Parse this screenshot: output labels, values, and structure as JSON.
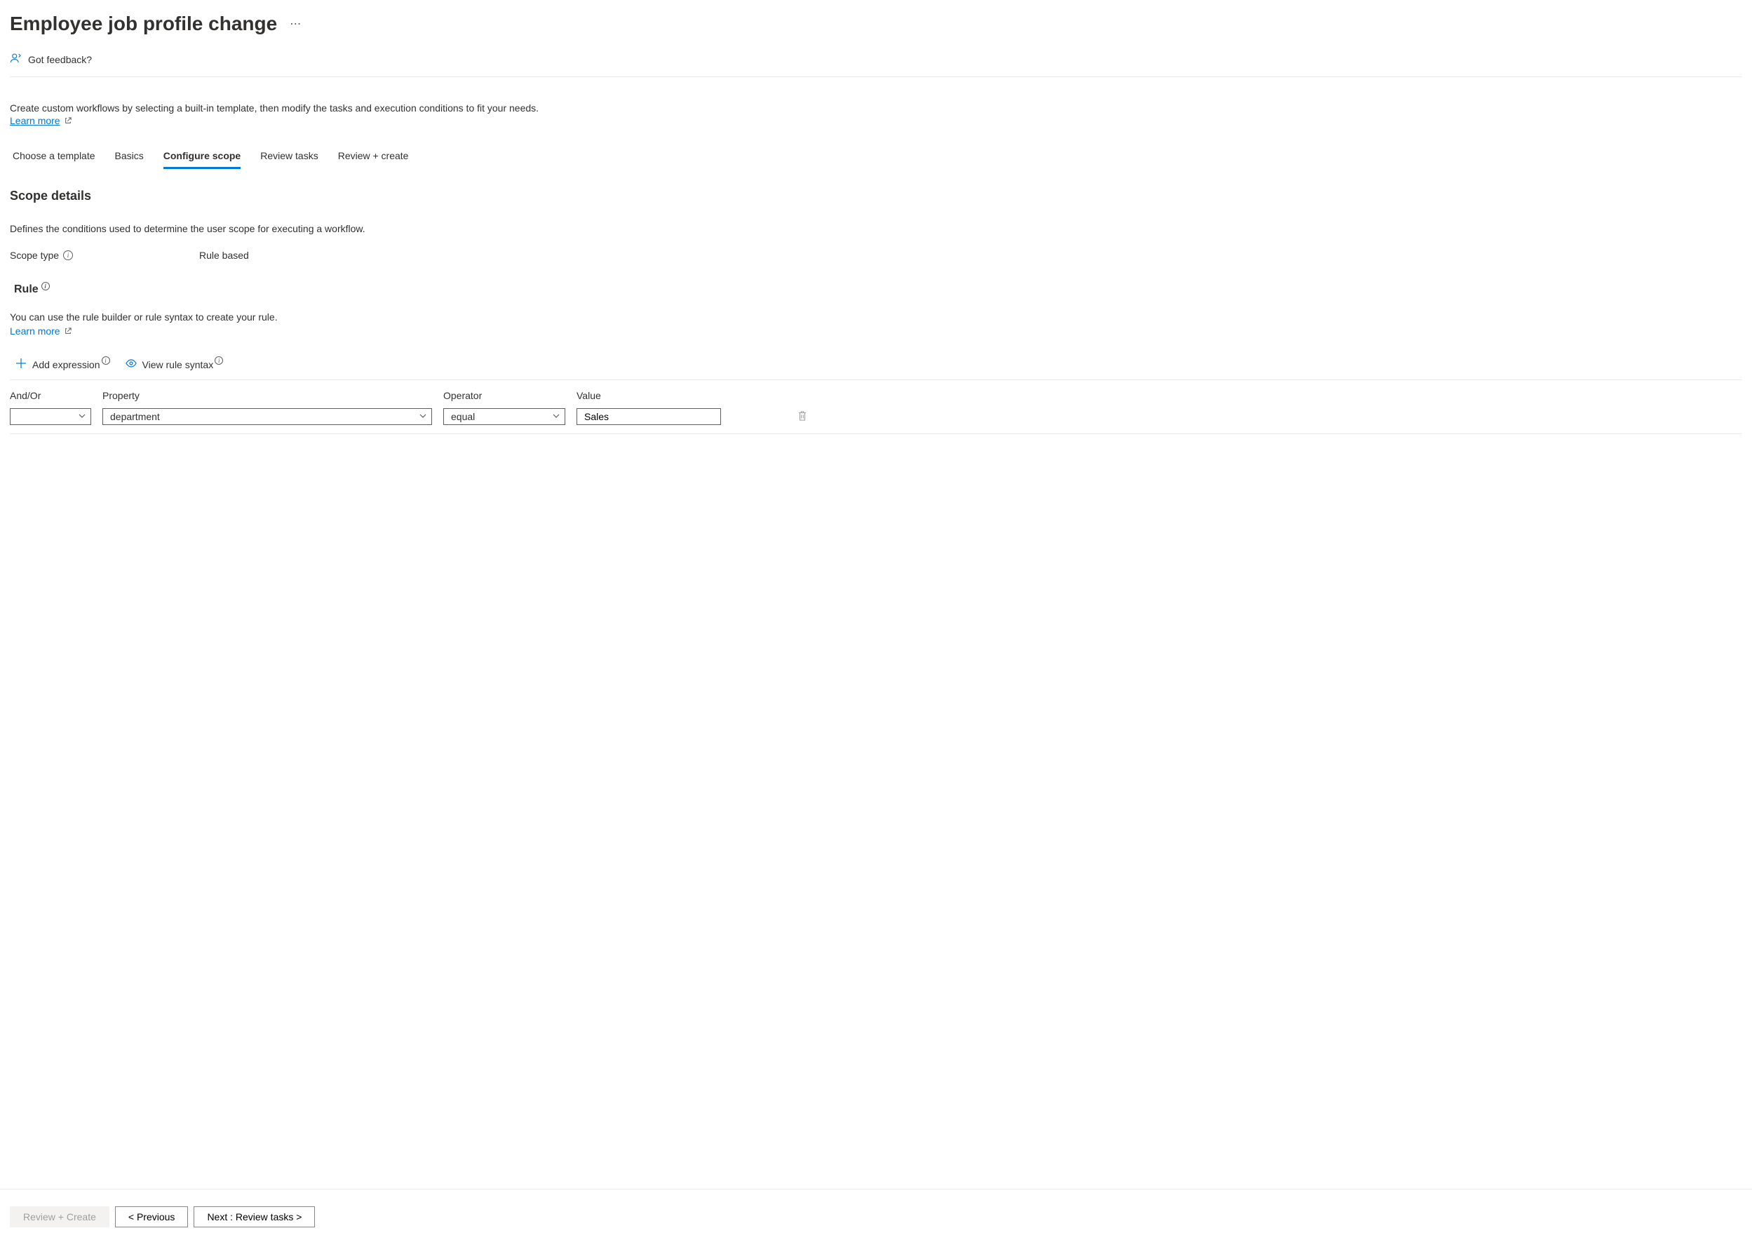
{
  "header": {
    "title": "Employee job profile change"
  },
  "feedback": {
    "label": "Got feedback?"
  },
  "intro": {
    "text": "Create custom workflows by selecting a built-in template, then modify the tasks and execution conditions to fit your needs.",
    "learn_more": "Learn more"
  },
  "tabs": [
    {
      "label": "Choose a template",
      "active": false
    },
    {
      "label": "Basics",
      "active": false
    },
    {
      "label": "Configure scope",
      "active": true
    },
    {
      "label": "Review tasks",
      "active": false
    },
    {
      "label": "Review + create",
      "active": false
    }
  ],
  "scope": {
    "heading": "Scope details",
    "description": "Defines the conditions used to determine the user scope for executing a workflow.",
    "type_label": "Scope type",
    "type_value": "Rule based"
  },
  "rule": {
    "heading": "Rule",
    "description": "You can use the rule builder or rule syntax to create your rule.",
    "learn_more": "Learn more",
    "add_expression": "Add expression",
    "view_syntax": "View rule syntax",
    "columns": {
      "andor": "And/Or",
      "property": "Property",
      "operator": "Operator",
      "value": "Value"
    },
    "rows": [
      {
        "andor": "",
        "property": "department",
        "operator": "equal",
        "value": "Sales"
      }
    ]
  },
  "footer": {
    "review_create": "Review + Create",
    "previous": "< Previous",
    "next": "Next : Review tasks >"
  }
}
